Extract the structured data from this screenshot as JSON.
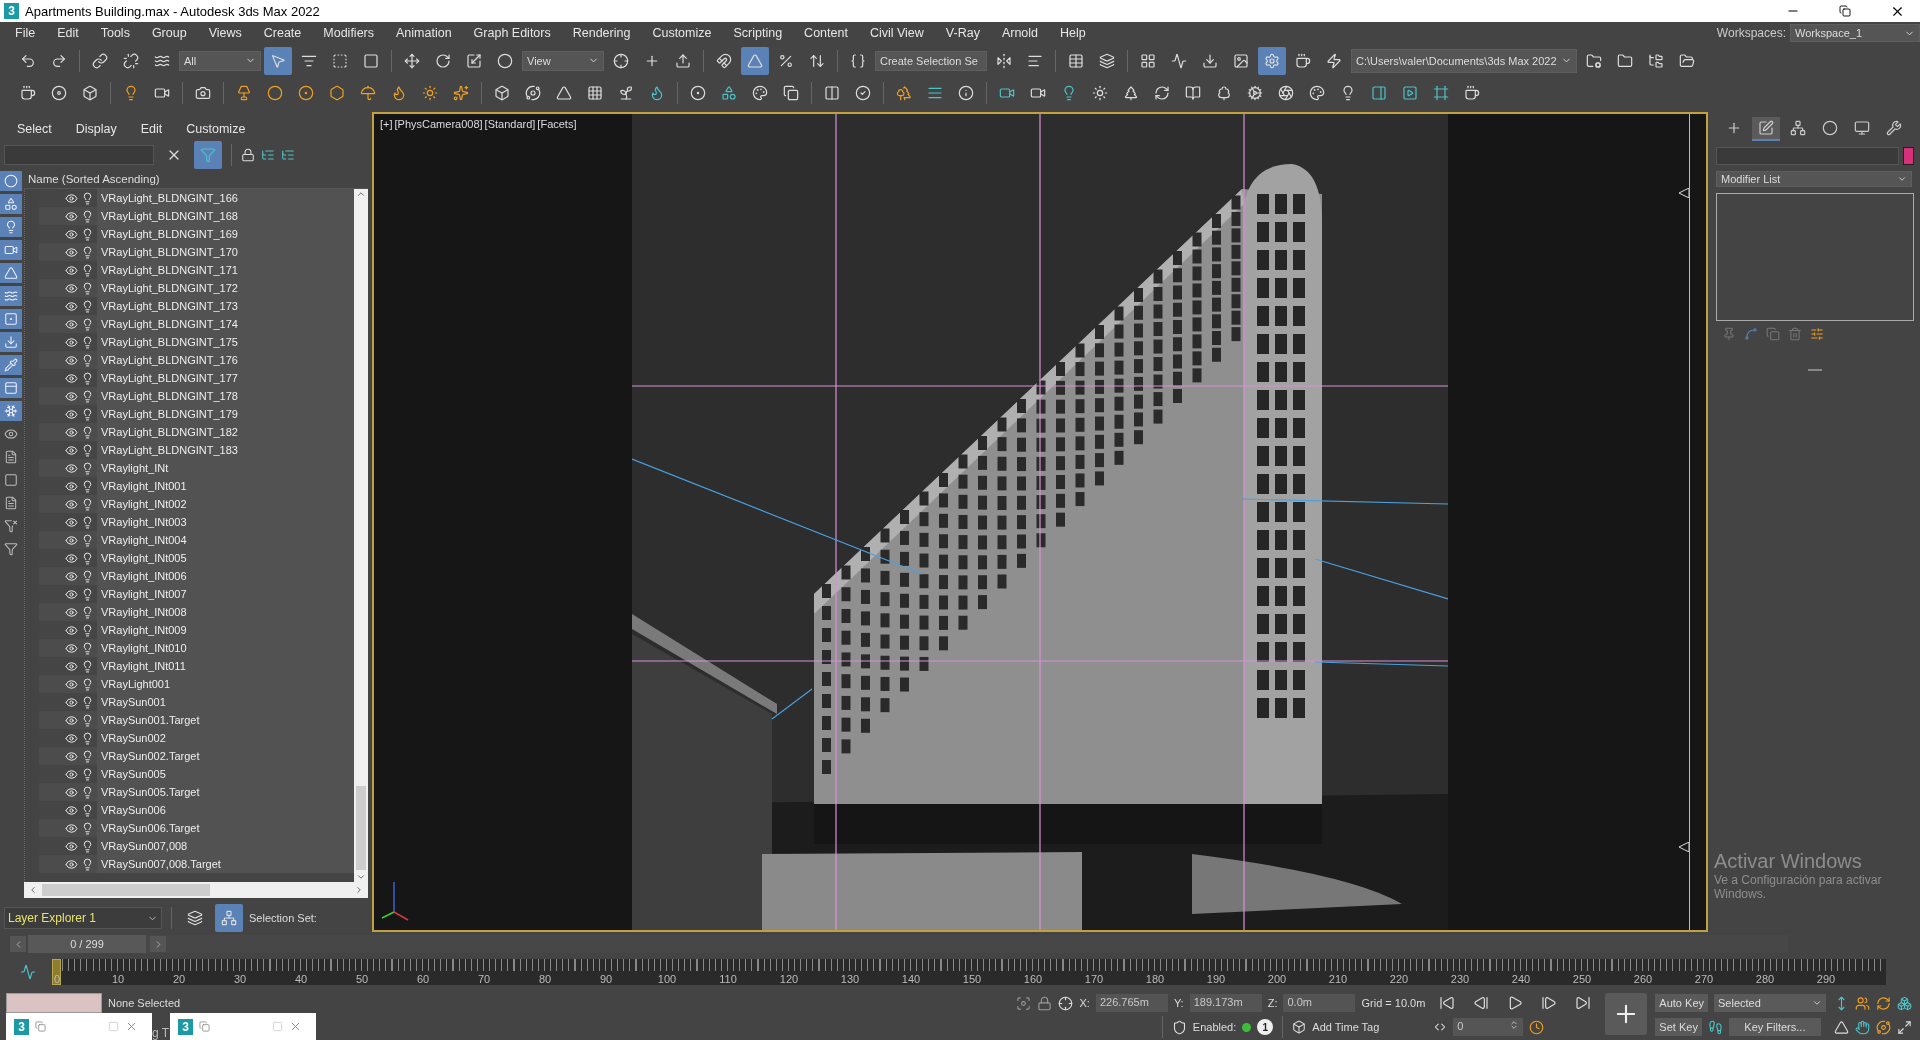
{
  "window": {
    "icon_text": "3",
    "title": "Apartments Building.max - Autodesk 3ds Max 2022"
  },
  "menu": [
    "File",
    "Edit",
    "Tools",
    "Group",
    "Views",
    "Create",
    "Modifiers",
    "Animation",
    "Graph Editors",
    "Rendering",
    "Customize",
    "Scripting",
    "Content",
    "Civil View",
    "V-Ray",
    "Arnold",
    "Help"
  ],
  "workspaces": {
    "label": "Workspaces:",
    "value": "Workspace_1"
  },
  "main_toolbar": {
    "selection_filter": "All",
    "reference_coordinate": "View",
    "named_selection_set": "Create Selection Se",
    "project_folder": "C:\\Users\\valer\\Documents\\3ds Max 2022",
    "buttons": [
      {
        "selected": false
      },
      {
        "selected": false
      },
      {
        "selected": false
      },
      {
        "selected": false
      },
      {
        "selected": false
      },
      {
        "selected": true
      },
      {
        "selected": false
      },
      {
        "selected": false
      },
      {
        "selected": false
      },
      {
        "selected": false
      },
      {
        "selected": false
      },
      {
        "selected": false
      },
      {
        "selected": false
      },
      {
        "selected": false
      },
      {
        "selected": false
      },
      {
        "selected": false
      },
      {
        "selected": false
      },
      {
        "selected": true
      },
      {
        "selected": false
      },
      {
        "selected": false
      },
      {
        "selected": false
      },
      {
        "selected": false
      },
      {
        "selected": false
      },
      {
        "selected": false
      },
      {
        "selected": false
      },
      {
        "selected": false
      },
      {
        "selected": false
      },
      {
        "selected": false
      },
      {
        "selected": false
      },
      {
        "selected": true
      },
      {
        "selected": false
      },
      {
        "selected": false
      },
      {
        "selected": false
      },
      {
        "selected": false
      },
      {
        "selected": false
      },
      {
        "selected": false
      }
    ]
  },
  "scene_explorer": {
    "menu": [
      "Select",
      "Display",
      "Edit",
      "Customize"
    ],
    "filter_toggle": {
      "selected": true
    },
    "filter_bar": [
      {
        "selected": true
      },
      {
        "selected": true
      },
      {
        "selected": true
      },
      {
        "selected": true
      },
      {
        "selected": true
      },
      {
        "selected": true
      },
      {
        "selected": true
      },
      {
        "selected": true
      },
      {
        "selected": true
      },
      {
        "selected": true
      },
      {
        "selected": true
      },
      {
        "selected": false
      },
      {
        "selected": false
      },
      {
        "selected": false
      },
      {
        "selected": false
      },
      {
        "selected": false
      },
      {
        "selected": false
      }
    ],
    "column": "Name (Sorted Ascending)",
    "items": [
      {
        "name": "VRayLight_BLDNGINT_166"
      },
      {
        "name": "VRayLight_BLDNGINT_168"
      },
      {
        "name": "VRayLight_BLDNGINT_169"
      },
      {
        "name": "VRayLight_BLDNGINT_170"
      },
      {
        "name": "VRayLight_BLDNGINT_171"
      },
      {
        "name": "VRayLight_BLDNGINT_172"
      },
      {
        "name": "VRayLight_BLDNGINT_173"
      },
      {
        "name": "VRayLight_BLDNGINT_174"
      },
      {
        "name": "VRayLight_BLDNGINT_175"
      },
      {
        "name": "VRayLight_BLDNGINT_176"
      },
      {
        "name": "VRayLight_BLDNGINT_177"
      },
      {
        "name": "VRayLight_BLDNGINT_178"
      },
      {
        "name": "VRayLight_BLDNGINT_179"
      },
      {
        "name": "VRayLight_BLDNGINT_182"
      },
      {
        "name": "VRayLight_BLDNGINT_183"
      },
      {
        "name": "VRaylight_INt"
      },
      {
        "name": "VRaylight_INt001"
      },
      {
        "name": "VRaylight_INt002"
      },
      {
        "name": "VRaylight_INt003"
      },
      {
        "name": "VRaylight_INt004"
      },
      {
        "name": "VRaylight_INt005"
      },
      {
        "name": "VRaylight_INt006"
      },
      {
        "name": "VRaylight_INt007"
      },
      {
        "name": "VRaylight_INt008"
      },
      {
        "name": "VRaylight_INt009"
      },
      {
        "name": "VRaylight_INt010"
      },
      {
        "name": "VRaylight_INt011"
      },
      {
        "name": "VRayLight001"
      },
      {
        "name": "VRaySun001"
      },
      {
        "name": "VRaySun001.Target"
      },
      {
        "name": "VRaySun002"
      },
      {
        "name": "VRaySun002.Target"
      },
      {
        "name": "VRaySun005"
      },
      {
        "name": "VRaySun005.Target"
      },
      {
        "name": "VRaySun006"
      },
      {
        "name": "VRaySun006.Target"
      },
      {
        "name": "VRaySun007,008"
      },
      {
        "name": "VRaySun007,008.Target"
      }
    ],
    "layer_explorer": "Layer Explorer 1",
    "selection_set_label": "Selection Set:"
  },
  "viewport": {
    "labels": [
      "[+]",
      "[PhysCamera008]",
      "[Standard]",
      "[Facets]"
    ]
  },
  "command_panel": {
    "tabs": [
      {
        "selected": false
      },
      {
        "selected": true
      },
      {
        "selected": false
      },
      {
        "selected": false
      },
      {
        "selected": false
      },
      {
        "selected": false
      }
    ],
    "modifier_list": "Modifier List"
  },
  "time_slider": {
    "reading": "0 / 299",
    "level": 0
  },
  "timeline": {
    "ticks": [
      "0",
      "10",
      "20",
      "30",
      "40",
      "50",
      "60",
      "70",
      "80",
      "90",
      "100",
      "110",
      "120",
      "130",
      "140",
      "150",
      "160",
      "170",
      "180",
      "190",
      "200",
      "210",
      "220",
      "230",
      "240",
      "250",
      "260",
      "270",
      "280",
      "290"
    ]
  },
  "status": {
    "selection": "None Selected",
    "coords": [
      {
        "label": "X:",
        "value": "226.765m"
      },
      {
        "label": "Y:",
        "value": "189.173m"
      },
      {
        "label": "Z:",
        "value": "0.0m"
      }
    ],
    "grid": "Grid = 10.0m",
    "enabled_label": "Enabled:",
    "enabled_count": "1",
    "add_time_tag": "Add Time Tag",
    "current_frame": "0",
    "auto_key": "Auto Key",
    "key_mode": "Selected",
    "set_key": "Set Key",
    "key_filters": "Key Filters..."
  },
  "taskbar": {
    "windows": [
      {
        "icon_text": "3"
      },
      {
        "icon_text": "3"
      }
    ],
    "partial_text": "g T"
  },
  "activation_notice": {
    "title": "Activar Windows",
    "text": "Ve a Configuración para activar Windows."
  }
}
